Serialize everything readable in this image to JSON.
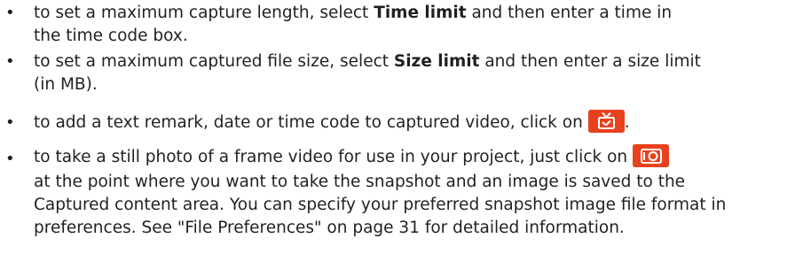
{
  "bullet_char": "•",
  "items": [
    {
      "lines": [
        {
          "pre": "to set a maximum capture length, select ",
          "bold": "Time limit",
          "post": " and then enter a time in"
        },
        {
          "text": "the time code box."
        }
      ]
    },
    {
      "lines": [
        {
          "pre": "to set a maximum captured file size, select ",
          "bold": "Size limit",
          "post": " and then enter a size limit"
        },
        {
          "text": "(in MB)."
        }
      ]
    },
    {
      "pre": "to add a text remark, date or time code to captured video, click on",
      "icon": "tv-text-overlay-icon",
      "post": "."
    },
    {
      "line1_pre": "to take a still photo of a frame video for use in your project, just click on",
      "icon": "camera-snapshot-icon",
      "lines": [
        "at the point where you want to take the snapshot and an image is saved to the",
        "Captured content area. You can specify your preferred snapshot image file format in",
        "preferences. See \"File Preferences\" on page 31 for detailed information."
      ]
    }
  ],
  "colors": {
    "text": "#231f20",
    "icon_bg": "#e8411e"
  }
}
